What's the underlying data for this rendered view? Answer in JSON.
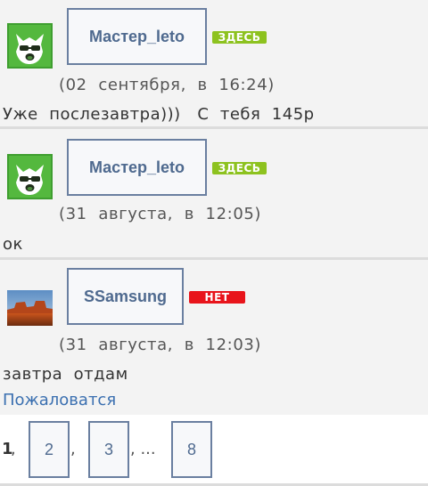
{
  "posts": [
    {
      "author": "Мастер_leto",
      "status": "ЗДЕСЬ",
      "time": "(02  сентября,  в  16:24)",
      "message": "Уже  послезавтра)))   С  тебя  145р"
    },
    {
      "author": "Мастер_leto",
      "status": "ЗДЕСЬ",
      "time": "(31  августа,  в  12:05)",
      "message": "ок"
    },
    {
      "author": "SSamsung",
      "status": "НЕТ",
      "time": "(31  августа,  в  12:03)",
      "message": "завтра  отдам",
      "report_link": "Пожаловатся"
    }
  ],
  "pagination": {
    "current": "1",
    "sep1": ",",
    "page2": "2",
    "sep2": ",",
    "page3": "3",
    "sep3": ", ...",
    "last": "8"
  },
  "colors": {
    "online_badge": "#8dc21f",
    "offline_badge": "#e8141b",
    "link": "#3a6fb0",
    "name": "#4f6a8f"
  }
}
